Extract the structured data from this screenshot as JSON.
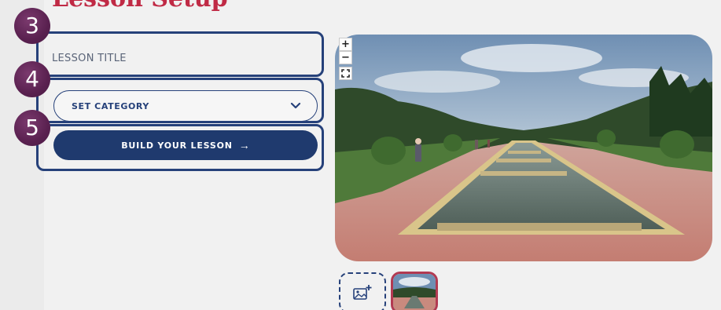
{
  "page": {
    "title": "Lesson Setup"
  },
  "steps": [
    {
      "number": "3"
    },
    {
      "number": "4"
    },
    {
      "number": "5"
    }
  ],
  "form": {
    "lesson_title_placeholder": "LESSON TITLE",
    "category_label": "SET CATEGORY",
    "build_button_label": "BUILD YOUR LESSON",
    "build_button_arrow": "→"
  },
  "viewer": {
    "zoom_in": "+",
    "zoom_out": "−",
    "fullscreen_icon": "fullscreen-icon"
  },
  "gallery": {
    "add_icon": "add-image-icon",
    "thumbnails": [
      {
        "icon": "panorama-thumbnail"
      }
    ]
  },
  "colors": {
    "title": "#c02a45",
    "primary": "#1f3a6e",
    "outline": "#26417a",
    "badge": "#5a2150",
    "thumb_border": "#b23a52"
  }
}
